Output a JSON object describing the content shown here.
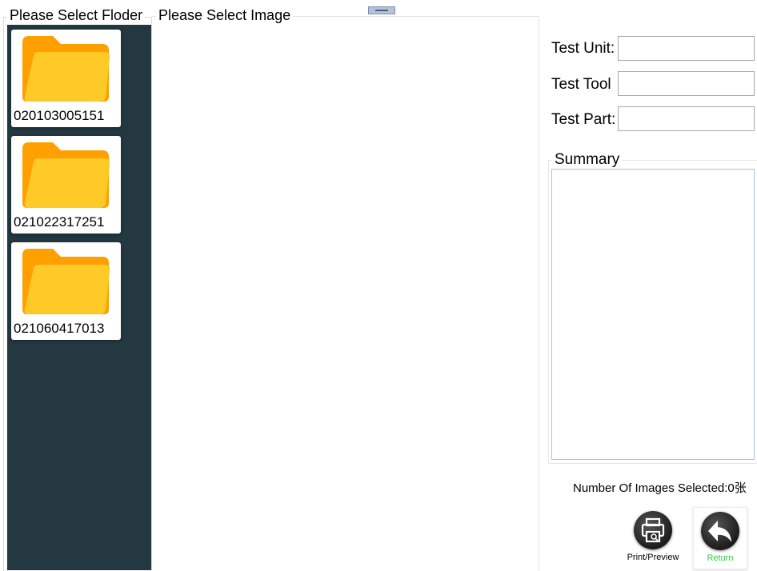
{
  "folder_panel": {
    "title": "Please Select Floder",
    "folders": [
      {
        "name": "020103005151",
        "icon": "folder-icon"
      },
      {
        "name": "021022317251",
        "icon": "folder-icon"
      },
      {
        "name": "021060417013",
        "icon": "folder-icon"
      }
    ]
  },
  "image_panel": {
    "title": "Please Select Image"
  },
  "form": {
    "test_unit_label": "Test Unit:",
    "test_unit_value": "",
    "test_tool_label": "Test Tool",
    "test_tool_value": "",
    "test_part_label": "Test Part:",
    "test_part_value": "",
    "summary_label": "Summary",
    "summary_value": ""
  },
  "status": {
    "images_selected": "Number Of Images Selected:0张"
  },
  "actions": {
    "print_label": "Print/Preview",
    "print_icon": "printer-icon",
    "return_label": "Return",
    "return_icon": "back-arrow-icon",
    "return_label_color": "#2ecc40"
  },
  "colors": {
    "folder_panel_bg": "#243841",
    "folder_back": "#ffa000",
    "folder_front": "#ffca28"
  }
}
